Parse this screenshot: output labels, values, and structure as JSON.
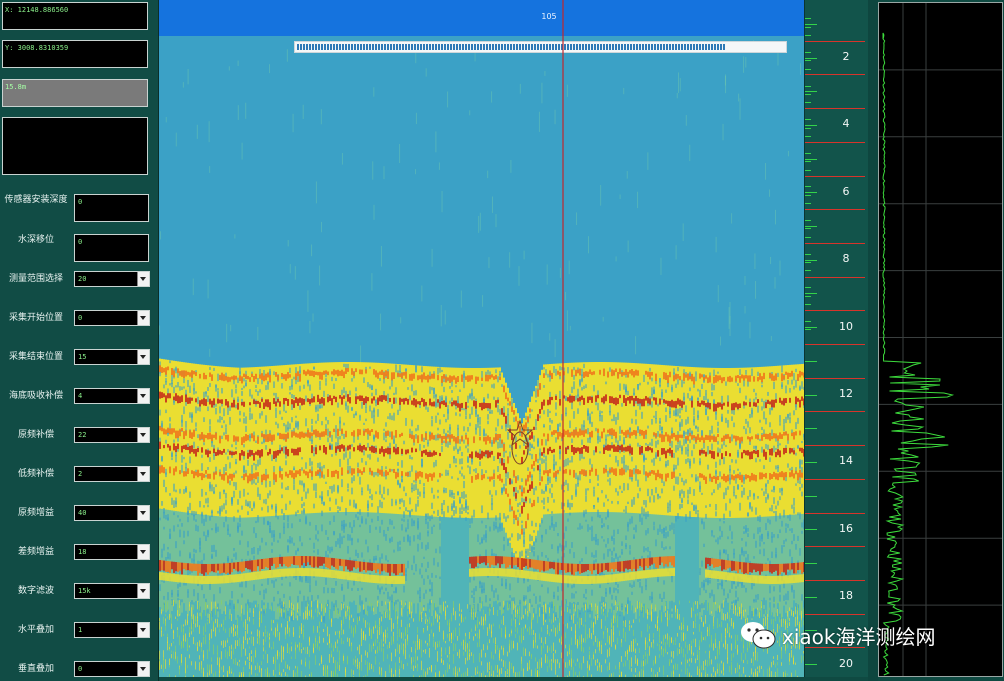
{
  "readouts": {
    "x": "X: 12148.886560",
    "y": "Y: 3008.8310359",
    "depth": "15.8m",
    "blank": ""
  },
  "params": [
    {
      "label": "传感器安装深度",
      "value": "0",
      "kind": "field"
    },
    {
      "label": "水深移位",
      "value": "0",
      "kind": "field"
    },
    {
      "label": "测量范围选择",
      "value": "20",
      "kind": "select"
    },
    {
      "label": "采集开始位置",
      "value": "0",
      "kind": "select"
    },
    {
      "label": "采集结束位置",
      "value": "15",
      "kind": "select"
    },
    {
      "label": "海底吸收补偿",
      "value": "4",
      "kind": "select"
    },
    {
      "label": "原频补偿",
      "value": "22",
      "kind": "select"
    },
    {
      "label": "低频补偿",
      "value": "2",
      "kind": "select"
    },
    {
      "label": "原频增益",
      "value": "40",
      "kind": "select"
    },
    {
      "label": "差频增益",
      "value": "18",
      "kind": "select"
    },
    {
      "label": "数字滤波",
      "value": "15k",
      "kind": "select"
    },
    {
      "label": "水平叠加",
      "value": "1",
      "kind": "select"
    },
    {
      "label": "垂直叠加",
      "value": "0",
      "kind": "select"
    }
  ],
  "echogram": {
    "ping_number": "105",
    "progress": 0.88,
    "colors": {
      "water": "#3ba1c6",
      "header": "#1573de",
      "cursor": "#c0272d",
      "strong": "#c8321b",
      "medium": "#f07a1c",
      "weak": "#f3e12a",
      "faint": "#8fd05a"
    }
  },
  "depth_scale": {
    "labels": [
      "2",
      "4",
      "6",
      "8",
      "10",
      "12",
      "14",
      "16",
      "18",
      "20"
    ],
    "max_depth": 20
  },
  "waveform": {
    "trace_color": "#3ddc3d"
  },
  "watermark": {
    "text": "xiaok海洋测绘网",
    "icon": "wechat-icon"
  }
}
